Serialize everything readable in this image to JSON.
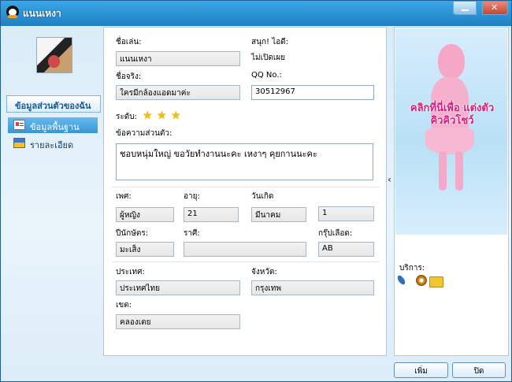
{
  "window": {
    "title": "แนนเหงา"
  },
  "sidebar": {
    "section_title": "ข้อมูลส่วนตัวของฉัน",
    "items": [
      {
        "label": "ข้อมูลพื้นฐาน",
        "active": true
      },
      {
        "label": "รายละเอียด",
        "active": false
      }
    ]
  },
  "profile": {
    "nickname_label": "ชื่อเล่น:",
    "nickname": "แนนเหงา",
    "fun_id_label": "สนุก! ไอดี:",
    "fun_id": "ไม่เปิดเผย",
    "realname_label": "ชื่อจริง:",
    "realname": "ใครมีกล้องแอดมาค่ะ",
    "qq_label": "QQ No.:",
    "qq": "30512967",
    "level_label": "ระดับ:",
    "level_stars": 3,
    "bio_label": "ข้อความส่วนตัว:",
    "bio": "ชอบหนุ่มใหญ่ ขอวัยทำงานนะคะ เหงาๆ คุยกานนะคะ",
    "gender_label": "เพศ:",
    "gender": "ผู้หญิง",
    "age_label": "อายุ:",
    "age": "21",
    "birthday_label": "วันเกิด",
    "birth_month": "มีนาคม",
    "birth_day": "1",
    "zodiac_label": "ปีนักษัตร:",
    "zodiac": "มะเส็ง",
    "sign_label": "ราศี:",
    "sign": "",
    "blood_label": "กรุ๊ปเลือด:",
    "blood": "AB",
    "country_label": "ประเทศ:",
    "country": "ประเทศไทย",
    "province_label": "จังหวัด:",
    "province": "กรุงเทพ",
    "district_label": "เขต:",
    "district": "คลองเตย"
  },
  "right_panel": {
    "promo": "คลิกที่นี่เพื่อ แต่งตัวคิวคิวโชว์",
    "services_label": "บริการ:"
  },
  "buttons": {
    "add": "เพิ่ม",
    "close": "ปิด"
  },
  "colors": {
    "accent": "#2a91d3",
    "promo_pink": "#d2227b",
    "star": "#f2c200"
  }
}
